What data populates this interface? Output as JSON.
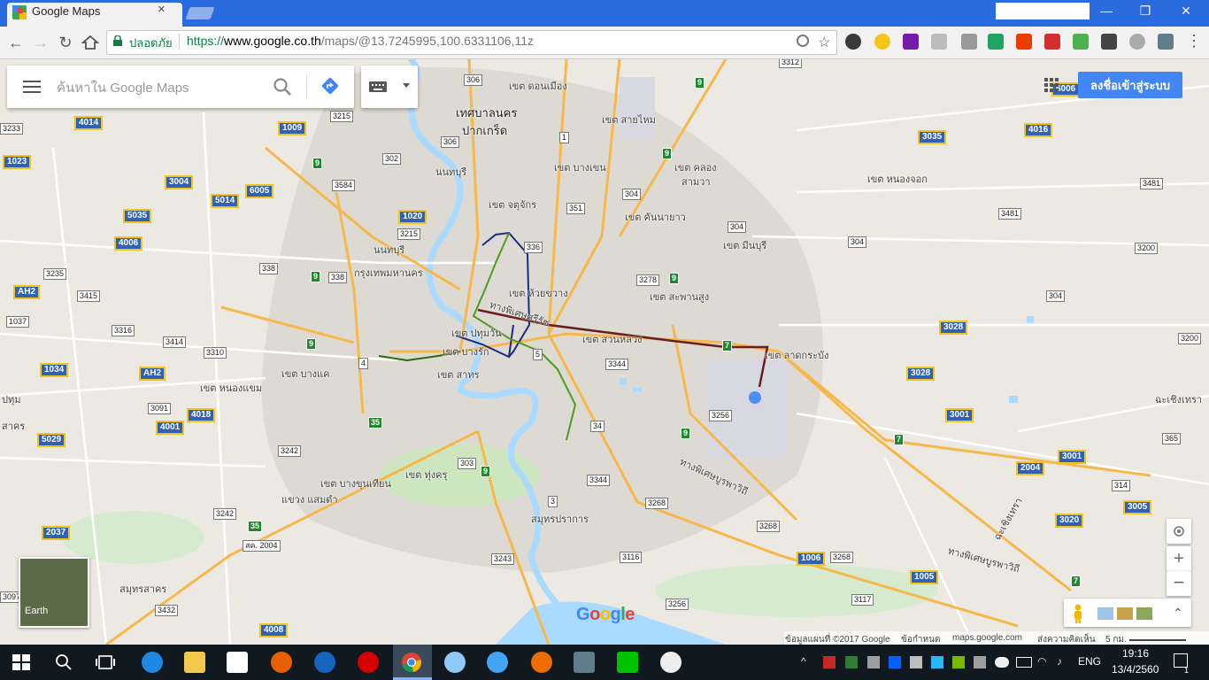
{
  "browser": {
    "tab_title": "Google Maps",
    "tab_close": "×",
    "url_secure_label": "ปลอดภัย",
    "url_scheme": "https://",
    "url_host": "www.google.co.th",
    "url_path": "/maps/@13.7245995,100.6331106,11z",
    "window_buttons": [
      "—",
      "❐",
      "✕"
    ]
  },
  "maps": {
    "search_placeholder": "ค้นหาใน Google Maps",
    "signin_label": "ลงชื่อเข้าสู่ระบบ",
    "earth_label": "Earth",
    "google_logo": "Google",
    "zoom_in": "+",
    "zoom_out": "−",
    "attribution": {
      "data": "ข้อมูลแผนที่ ©2017 Google",
      "terms": "ข้อกำหนด",
      "site": "maps.google.com",
      "feedback": "ส่งความคิดเห็น",
      "scale": "5 กม."
    },
    "place_labels": [
      "เทศบาลนคร",
      "ปากเกร็ด",
      "เขต ดอนเมือง",
      "เขต สายไหม",
      "เขต บางเขน",
      "เขต คลอง",
      "สามวา",
      "เขต หนองจอก",
      "นนทบุรี",
      "เขต จตุจักร",
      "เขต คันนายาว",
      "เขต มีนบุรี",
      "นนทบุรี",
      "กรุงเทพมหานคร",
      "เขต ห้วยขวาง",
      "เขต สะพานสูง",
      "เขต ปทุมวัน",
      "เขต สวนหลวง",
      "เขต ลาดกระบัง",
      "เขต บางรัก",
      "เขต บางแค",
      "เขต หนองแขม",
      "เขต สาทร",
      "เขต ทุ่งครุ",
      "เขต บางขุนเทียน",
      "แขวง แสมดำ",
      "สมุทรปราการ",
      "สมุทรสาคร",
      "ทางพิเศษศรีรัช",
      "ทางพิเศษบูรพาวิถี",
      "ทางพิเศษบูรพาวิถี",
      "ฉะเชิงเทรา",
      "ฉะเชิงเทรา",
      "ปทุม",
      "สาคร"
    ],
    "shields_yellow": [
      "4014",
      "1009",
      "1023",
      "3004",
      "6005",
      "5014",
      "5035",
      "1020",
      "4006",
      "1034",
      "4018",
      "4001",
      "5029",
      "2037",
      "4008",
      "3035",
      "4016",
      "3028",
      "3028",
      "3001",
      "2004",
      "3001",
      "3020",
      "3005",
      "1006",
      "1005",
      "6006",
      "AH2",
      "AH2"
    ],
    "shields_white": [
      "3312",
      "306",
      "3215",
      "306",
      "302",
      "3584",
      "3481",
      "3215",
      "351",
      "304",
      "304",
      "304",
      "3481",
      "3200",
      "3235",
      "338",
      "338",
      "336",
      "3278",
      "3415",
      "1037",
      "3316",
      "3414",
      "3310",
      "3344",
      "3256",
      "3200",
      "304",
      "3091",
      "3242",
      "303",
      "34",
      "3344",
      "3268",
      "3268",
      "3242",
      "3243",
      "3116",
      "3268",
      "3117",
      "3256",
      "3432",
      "3097",
      "314",
      "365",
      "3233",
      "1",
      "4",
      "5",
      "3",
      "สค. 2004"
    ],
    "shields_green": [
      "9",
      "9",
      "9",
      "9",
      "9",
      "9",
      "9",
      "7",
      "7",
      "7",
      "35",
      "35",
      "9"
    ]
  },
  "taskbar": {
    "lang": "ENG",
    "time": "19:16",
    "date": "13/4/2560",
    "notification_count": "1"
  },
  "colors": {
    "tab_strip": "#2b6be0",
    "signin": "#4285f4",
    "water": "#aadaff",
    "highway": "#f7b84b",
    "green_area": "#cde6bf",
    "urban": "#dcdad3"
  }
}
